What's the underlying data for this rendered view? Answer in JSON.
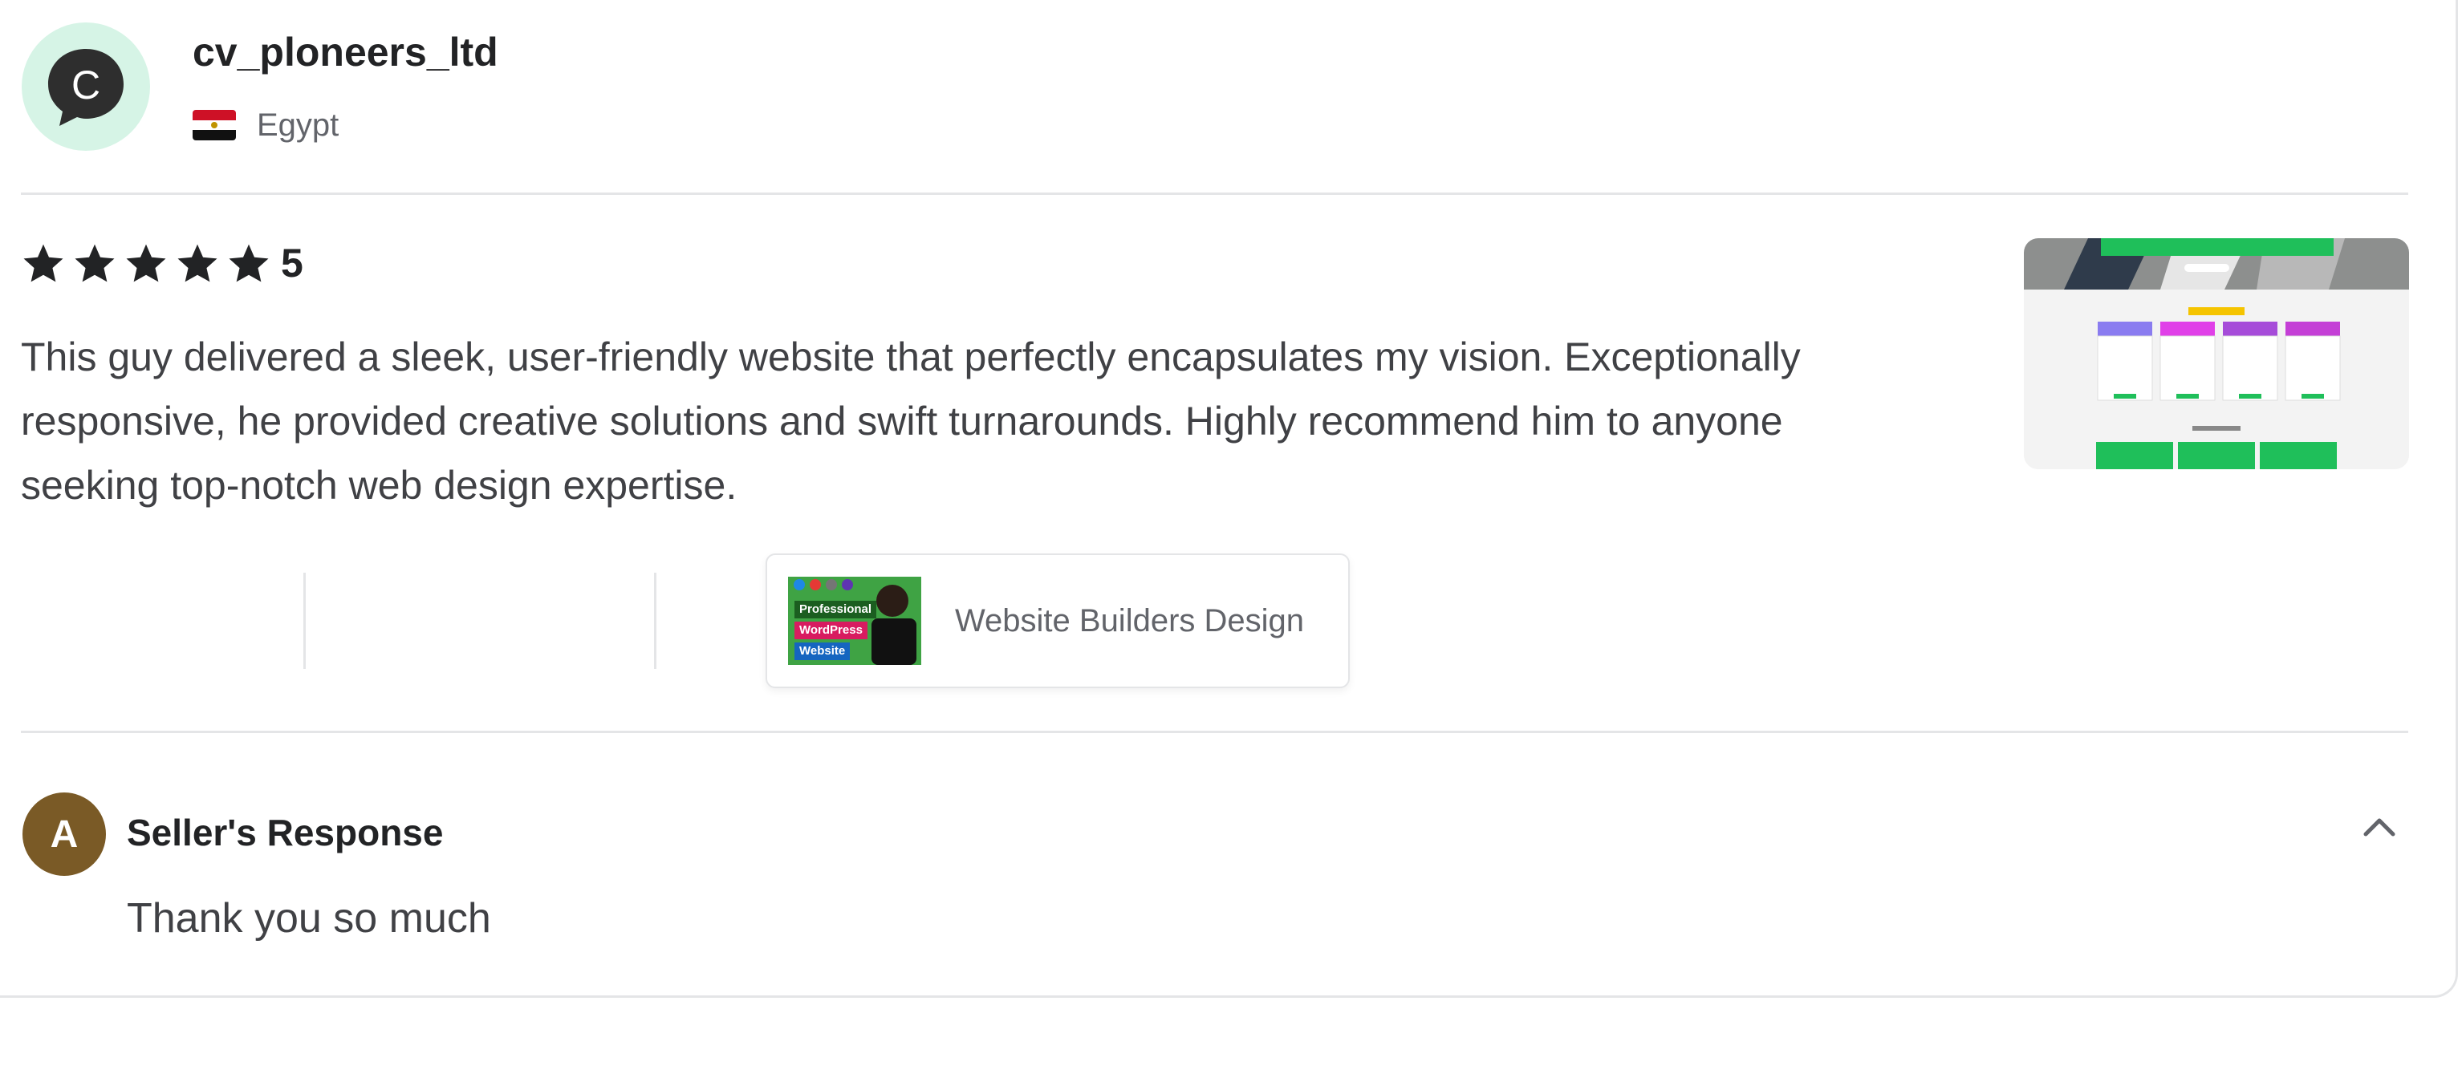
{
  "reviewer": {
    "avatar_letter": "C",
    "avatar_icon": "chat-bubble-icon",
    "name": "cv_ploneers_ltd",
    "country": "Egypt",
    "flag_icon": "egypt-flag-icon"
  },
  "review": {
    "rating": 5,
    "rating_label": "5",
    "text": "This guy delivered a sleek, user-friendly website that perfectly encapsulates my vision. Exceptionally responsive, he provided creative solutions and swift turnarounds. Highly recommend him to anyone seeking top-notch web design expertise."
  },
  "gig": {
    "title": "Website Builders Design",
    "thumb_lines": [
      "Professional",
      "WordPress",
      "Website"
    ]
  },
  "response": {
    "avatar_letter": "A",
    "title": "Seller's Response",
    "text": "Thank you so much"
  },
  "colors": {
    "star": "#222325",
    "avatar_bg": "#d6f4e6",
    "seller_avatar_bg": "#7a5a26",
    "gig_thumb_bg": "#3fa344"
  }
}
